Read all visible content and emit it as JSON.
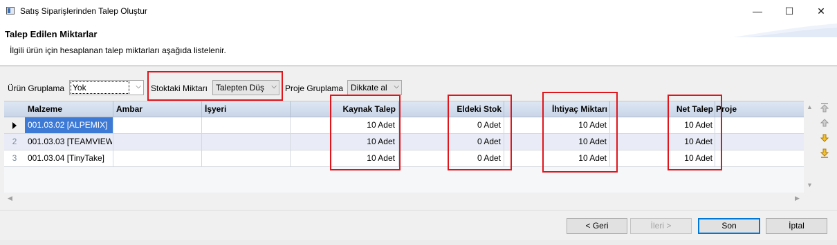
{
  "window": {
    "title": "Satış Siparişlerinden Talep Oluştur",
    "minimize": "—",
    "maximize": "☐",
    "close": "✕"
  },
  "header": {
    "title": "Talep Edilen Miktarlar",
    "description": "İlgili ürün için hesaplanan talep miktarları aşağıda listelenir."
  },
  "filters": {
    "urun_gruplama_label": "Ürün Gruplama",
    "urun_gruplama_value": "Yok",
    "stoktaki_miktari_label": "Stoktaki Miktarı",
    "stoktaki_miktari_value": "Talepten Düş",
    "proje_gruplama_label": "Proje Gruplama",
    "proje_gruplama_value": "Dikkate al"
  },
  "grid": {
    "columns": [
      "Malzeme",
      "Ambar",
      "İşyeri",
      "Kaynak Talep",
      "Eldeki Stok",
      "İhtiyaç Miktarı",
      "Net Talep",
      "Proje"
    ],
    "rows": [
      {
        "num": "",
        "malzeme": "001.03.02 [ALPEMIX]",
        "ambar": "",
        "isyeri": "",
        "kaynak_talep": "10 Adet",
        "eldeki_stok": "0 Adet",
        "ihtiyac_miktari": "10 Adet",
        "net_talep": "10 Adet",
        "proje": ""
      },
      {
        "num": "2",
        "malzeme": "001.03.03 [TEAMVIEW...",
        "ambar": "",
        "isyeri": "",
        "kaynak_talep": "10 Adet",
        "eldeki_stok": "0 Adet",
        "ihtiyac_miktari": "10 Adet",
        "net_talep": "10 Adet",
        "proje": ""
      },
      {
        "num": "3",
        "malzeme": "001.03.04 [TinyTake]",
        "ambar": "",
        "isyeri": "",
        "kaynak_talep": "10 Adet",
        "eldeki_stok": "0 Adet",
        "ihtiyac_miktari": "10 Adet",
        "net_talep": "10 Adet",
        "proje": ""
      }
    ]
  },
  "buttons": {
    "back": "< Geri",
    "next": "İleri >",
    "finish": "Son",
    "cancel": "İptal"
  },
  "colors": {
    "selection": "#3d7ad6",
    "highlight_box": "#e0141b",
    "header_gradient": "#c9d6e8"
  },
  "icons": [
    "app-icon",
    "move-top-icon",
    "move-up-icon",
    "move-down-icon",
    "move-bottom-icon"
  ]
}
